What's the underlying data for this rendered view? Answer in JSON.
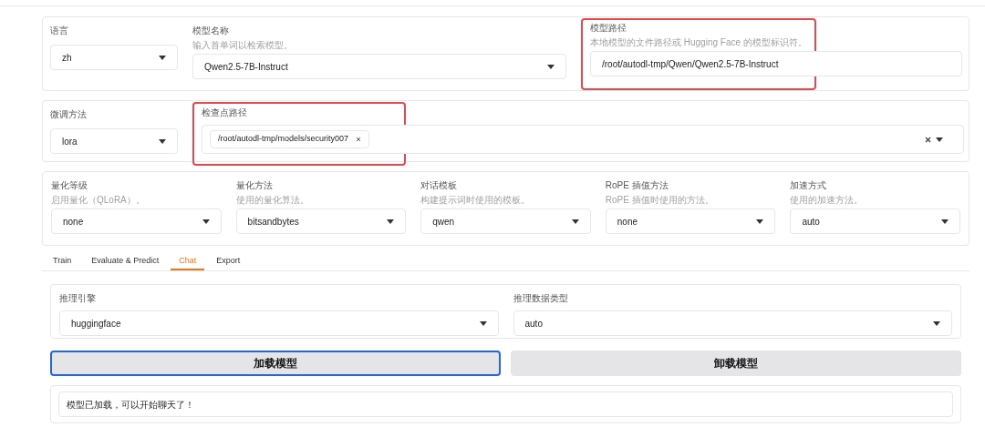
{
  "top_row": {
    "language": {
      "label": "语言",
      "value": "zh"
    },
    "model_name": {
      "label": "模型名称",
      "hint": "输入首单词以检索模型。",
      "value": "Qwen2.5-7B-Instruct"
    },
    "model_path": {
      "label": "模型路径",
      "hint": "本地模型的文件路径或 Hugging Face 的模型标识符。",
      "value": "/root/autodl-tmp/Qwen/Qwen2.5-7B-Instruct",
      "highlighted": true
    }
  },
  "finetune_row": {
    "method": {
      "label": "微调方法",
      "value": "lora"
    },
    "checkpoint": {
      "label": "检查点路径",
      "chips": [
        "/root/autodl-tmp/models/security007"
      ],
      "highlighted": true
    }
  },
  "advanced_row": [
    {
      "label": "量化等级",
      "hint": "启用量化（QLoRA）。",
      "value": "none"
    },
    {
      "label": "量化方法",
      "hint": "使用的量化算法。",
      "value": "bitsandbytes"
    },
    {
      "label": "对话模板",
      "hint": "构建提示词时使用的模板。",
      "value": "qwen"
    },
    {
      "label": "RoPE 插值方法",
      "hint": "RoPE 插值时使用的方法。",
      "value": "none"
    },
    {
      "label": "加速方式",
      "hint": "使用的加速方法。",
      "value": "auto"
    }
  ],
  "tabs": [
    {
      "label": "Train",
      "selected": false
    },
    {
      "label": "Evaluate & Predict",
      "selected": false
    },
    {
      "label": "Chat",
      "selected": true
    },
    {
      "label": "Export",
      "selected": false
    }
  ],
  "chat": {
    "engine": {
      "label": "推理引擎",
      "value": "huggingface"
    },
    "dtype": {
      "label": "推理数据类型",
      "value": "auto"
    }
  },
  "buttons": [
    {
      "label": "加载模型",
      "focused": true
    },
    {
      "label": "卸载模型",
      "focused": false
    }
  ],
  "status": {
    "value": "模型已加载，可以开始聊天了！"
  }
}
